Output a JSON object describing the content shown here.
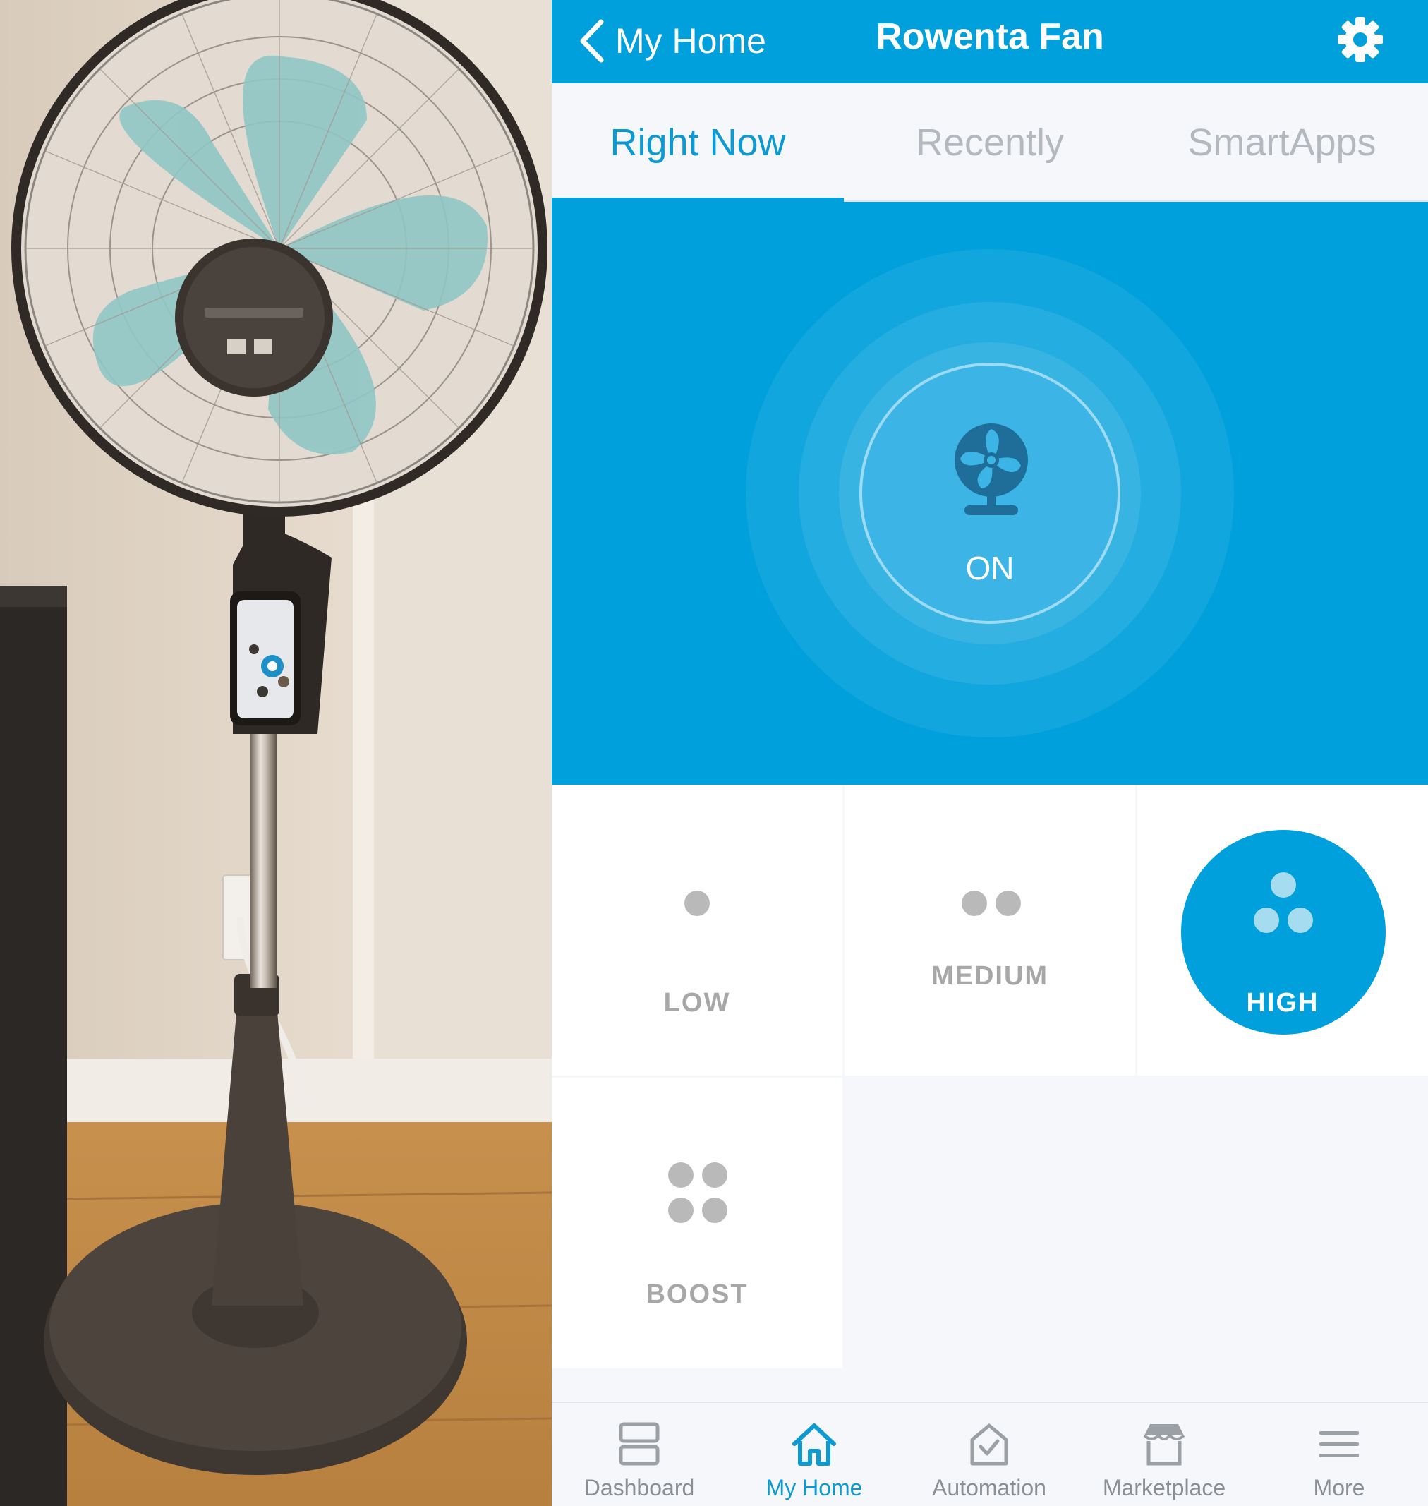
{
  "header": {
    "back_label": "My Home",
    "title": "Rowenta Fan"
  },
  "tabs": [
    {
      "label": "Right Now",
      "active": true
    },
    {
      "label": "Recently",
      "active": false
    },
    {
      "label": "SmartApps",
      "active": false
    }
  ],
  "device": {
    "state_label": "ON",
    "icon": "fan-icon"
  },
  "speeds": [
    {
      "label": "LOW",
      "selected": false
    },
    {
      "label": "MEDIUM",
      "selected": false
    },
    {
      "label": "HIGH",
      "selected": true
    },
    {
      "label": "BOOST",
      "selected": false
    }
  ],
  "bottom_nav": [
    {
      "label": "Dashboard",
      "icon": "dashboard-icon",
      "active": false
    },
    {
      "label": "My Home",
      "icon": "home-icon",
      "active": true
    },
    {
      "label": "Automation",
      "icon": "automation-icon",
      "active": false
    },
    {
      "label": "Marketplace",
      "icon": "marketplace-icon",
      "active": false
    },
    {
      "label": "More",
      "icon": "menu-icon",
      "active": false
    }
  ],
  "colors": {
    "accent": "#00a0dc",
    "inactive_text": "#b4b9c0",
    "dot_gray": "#b9b9b9"
  }
}
